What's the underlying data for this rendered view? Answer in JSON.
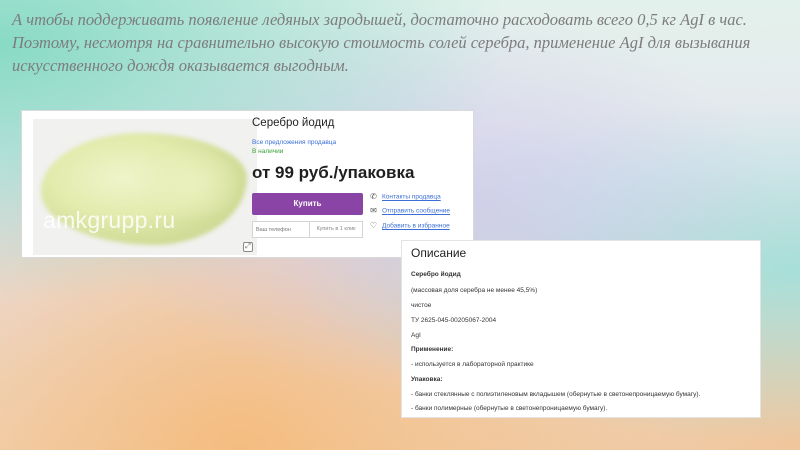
{
  "slide": {
    "text": "А чтобы поддерживать появление ледяных зародышей, достаточно расходовать всего 0,5 кг AgI в час. Поэтому, несмотря на сравнительно высокую стоимость солей серебра, применение AgI для вызывания искусственного дождя оказывается выгодным."
  },
  "product": {
    "title": "Серебро йодид",
    "all_offers_link": "Все предложения продавца",
    "stock_status": "В наличии",
    "price": "от 99 руб./упаковка",
    "buy_label": "Купить",
    "phone_placeholder": "Ваш телефон",
    "one_click_label": "Купить в 1 клик",
    "photo_watermark": "amkgrupp.ru",
    "zoom_icon": "zoom-icon",
    "accent_color": "#8a44a6",
    "links": {
      "contacts": "Контакты продавца",
      "message": "Отправить сообщение",
      "favorite": "Добавить в избранное"
    }
  },
  "description": {
    "heading": "Описание",
    "lines": [
      "Серебро йодид",
      "(массовая доля серебра не менее 45,5%)",
      "чистое",
      "ТУ 2625-045-00205067-2004",
      "AgI",
      "Применение:",
      "- используется в лабораторной практике",
      "Упаковка:",
      "- банки стеклянные с полиэтиленовым вкладышем (обернутые в светонепроницаемую бумагу).",
      "- банки полимерные (обернутые в светонепроницаемую бумагу)."
    ]
  }
}
